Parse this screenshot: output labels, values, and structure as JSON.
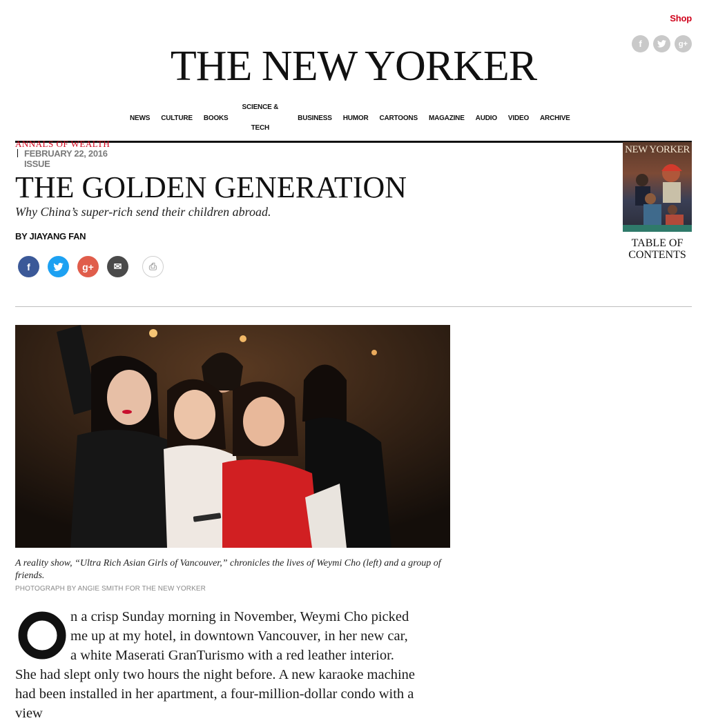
{
  "header": {
    "shop_label": "Shop",
    "logo_text": "THE NEW YORKER",
    "social_icons": [
      "facebook-icon",
      "twitter-icon",
      "google-plus-icon"
    ]
  },
  "nav": {
    "items": [
      {
        "label": "NEWS"
      },
      {
        "label": "CULTURE"
      },
      {
        "label": "BOOKS"
      },
      {
        "label_line1": "SCIENCE &",
        "label_line2": "TECH"
      },
      {
        "label": "BUSINESS"
      },
      {
        "label": "HUMOR"
      },
      {
        "label": "CARTOONS"
      },
      {
        "label": "MAGAZINE"
      },
      {
        "label": "AUDIO"
      },
      {
        "label": "VIDEO"
      },
      {
        "label": "ARCHIVE"
      }
    ]
  },
  "article": {
    "rubric": "ANNALS OF WEALTH",
    "issue_line1": "FEBRUARY 22, 2016",
    "issue_line2": "ISSUE",
    "headline": "THE GOLDEN GENERATION",
    "dek": "Why China’s super-rich send their children abroad.",
    "byline": "BY JIAYANG FAN",
    "share": {
      "facebook_glyph": "f",
      "twitter_glyph": "t",
      "google_glyph": "g+",
      "email_glyph": "✉",
      "print_glyph": "⎙"
    }
  },
  "cover": {
    "masthead": "NEW YORKER",
    "toc_label": "TABLE OF CONTENTS"
  },
  "photo": {
    "caption": "A reality show, “Ultra Rich Asian Girls of Vancouver,” chronicles the lives of Weymi Cho (left) and a group of friends.",
    "credit": "PHOTOGRAPH BY ANGIE SMITH FOR THE NEW YORKER"
  },
  "body": {
    "dropcap": "O",
    "text": "n a crisp Sunday morning in November, Weymi Cho picked me up at my hotel, in downtown Vancouver, in her new car, a white Maserati GranTurismo with a red leather interior. She had slept only two hours the night before. A new karaoke machine had been installed in her apartment, a four-million-dollar condo with a view"
  },
  "colors": {
    "accent_red": "#d0021b",
    "facebook": "#3b5998",
    "twitter": "#1da1f2",
    "google_plus": "#e05d4b",
    "email": "#4a4a4a"
  }
}
